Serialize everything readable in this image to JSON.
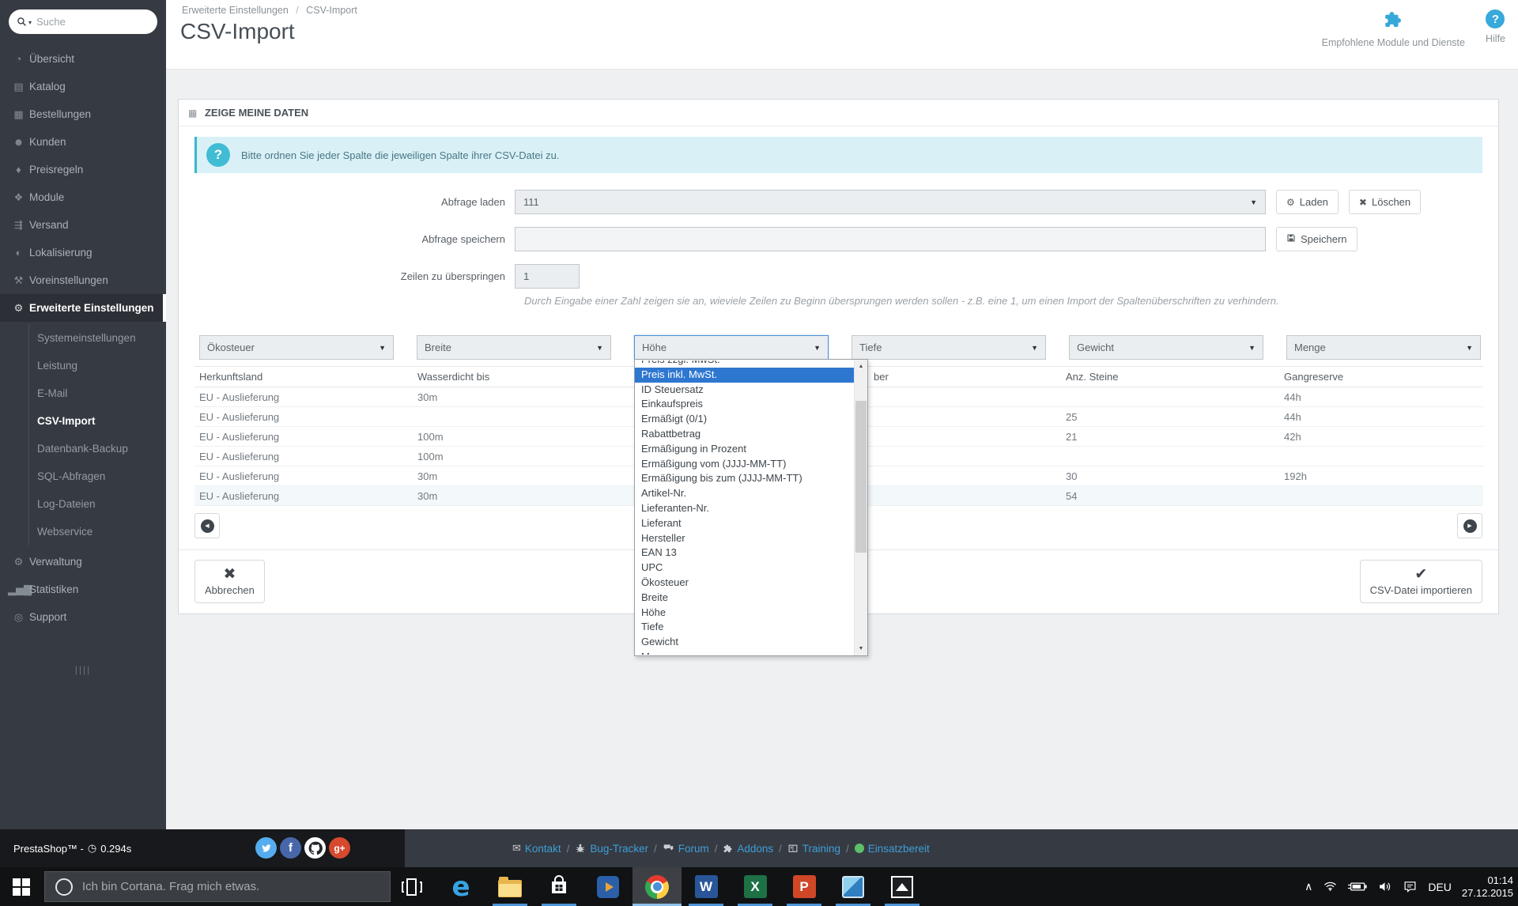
{
  "colors": {
    "accent_blue": "#35a9db",
    "selection_blue": "#2e77d0",
    "alert_teal": "#41bcd5",
    "link_blue": "#3d9fd9",
    "status_green": "#5cc06a"
  },
  "icons": {
    "select_caret": "▼",
    "menu_caret": "▾",
    "gear": "⚙",
    "cross": "✖",
    "check": "✔",
    "question_mark": "?",
    "clock": "◷",
    "prev": "◀",
    "next": "▶",
    "panel": "▦",
    "envelope": "✉",
    "scroll_up": "▲",
    "scroll_down": "▼"
  },
  "sidebar": {
    "search_placeholder": "Suche",
    "menu_top": [
      {
        "icon": "◔",
        "label": "Übersicht"
      },
      {
        "icon": "▤",
        "label": "Katalog"
      },
      {
        "icon": "▦",
        "label": "Bestellungen"
      },
      {
        "icon": "☻",
        "label": "Kunden"
      },
      {
        "icon": "♦",
        "label": "Preisregeln"
      },
      {
        "icon": "❖",
        "label": "Module"
      },
      {
        "icon": "⇶",
        "label": "Versand"
      },
      {
        "icon": "◐",
        "label": "Lokalisierung"
      },
      {
        "icon": "⚒",
        "label": "Voreinstellungen"
      },
      {
        "icon": "⚙",
        "label": "Erweiterte Einstellungen",
        "active": true
      }
    ],
    "submenu": [
      {
        "label": "Systemeinstellungen"
      },
      {
        "label": "Leistung"
      },
      {
        "label": "E-Mail"
      },
      {
        "label": "CSV-Import",
        "active": true
      },
      {
        "label": "Datenbank-Backup"
      },
      {
        "label": "SQL-Abfragen"
      },
      {
        "label": "Log-Dateien"
      },
      {
        "label": "Webservice"
      }
    ],
    "menu_bottom": [
      {
        "icon": "⚙",
        "label": "Verwaltung"
      },
      {
        "icon": "▂▅▇",
        "label": "Statistiken"
      },
      {
        "icon": "◎",
        "label": "Support"
      }
    ],
    "collapse_glyph": "||||"
  },
  "header": {
    "breadcrumb": [
      "Erweiterte Einstellungen",
      "CSV-Import"
    ],
    "breadcrumb_separator": "/",
    "title": "CSV-Import",
    "recommended_modules_label": "Empfohlene Module und Dienste",
    "help_label": "Hilfe"
  },
  "panel": {
    "title": "ZEIGE MEINE DATEN",
    "info_text": "Bitte ordnen Sie jeder Spalte die jeweiligen Spalte ihrer CSV-Datei zu.",
    "form": {
      "load_label": "Abfrage laden",
      "load_value": "111",
      "load_button": "Laden",
      "delete_button": "Löschen",
      "save_label": "Abfrage speichern",
      "save_value": "",
      "save_button": "Speichern",
      "skip_label": "Zeilen zu überspringen",
      "skip_value": "1",
      "skip_help": "Durch Eingabe einer Zahl zeigen sie an, wieviele Zeilen zu Beginn übersprungen werden sollen - z.B. eine 1, um einen Import der Spaltenüberschriften zu verhindern."
    },
    "column_selects": [
      {
        "value": "Ökosteuer"
      },
      {
        "value": "Breite"
      },
      {
        "value": "Höhe",
        "focused": true
      },
      {
        "value": "Tiefe"
      },
      {
        "value": "Gewicht"
      },
      {
        "value": "Menge"
      }
    ],
    "dropdown": {
      "options": [
        {
          "label": "Preis zzgl. MwSt."
        },
        {
          "label": "Preis inkl. MwSt.",
          "selected": true
        },
        {
          "label": "ID Steuersatz"
        },
        {
          "label": "Einkaufspreis"
        },
        {
          "label": "Ermäßigt (0/1)"
        },
        {
          "label": "Rabattbetrag"
        },
        {
          "label": "Ermäßigung in Prozent"
        },
        {
          "label": "Ermäßigung vom (JJJJ-MM-TT)"
        },
        {
          "label": "Ermäßigung bis zum (JJJJ-MM-TT)"
        },
        {
          "label": "Artikel-Nr."
        },
        {
          "label": "Lieferanten-Nr."
        },
        {
          "label": "Lieferant"
        },
        {
          "label": "Hersteller"
        },
        {
          "label": "EAN 13"
        },
        {
          "label": "UPC"
        },
        {
          "label": "Ökosteuer"
        },
        {
          "label": "Breite"
        },
        {
          "label": "Höhe"
        },
        {
          "label": "Tiefe"
        },
        {
          "label": "Gewicht"
        },
        {
          "label": "Menge"
        }
      ]
    },
    "table": {
      "headers": [
        "Herkunftsland",
        "Wasserdicht bis",
        "",
        "ber",
        "Anz. Steine",
        "Gangreserve"
      ],
      "rows": [
        [
          "EU - Auslieferung",
          "30m",
          "",
          "",
          "",
          "44h"
        ],
        [
          "EU - Auslieferung",
          "",
          "",
          "",
          "25",
          "44h"
        ],
        [
          "EU - Auslieferung",
          "100m",
          "",
          "",
          "21",
          "42h"
        ],
        [
          "EU - Auslieferung",
          "100m",
          "",
          "",
          "",
          ""
        ],
        [
          "EU - Auslieferung",
          "30m",
          "",
          "",
          "30",
          "192h"
        ],
        [
          "EU - Auslieferung",
          "30m",
          "",
          "",
          "54",
          ""
        ]
      ]
    },
    "cancel_button": "Abbrechen",
    "import_button": "CSV-Datei importieren"
  },
  "footer": {
    "brand": "PrestaShop™ -",
    "load_time": "0.294s",
    "separator": "/",
    "links": [
      {
        "label": "Kontakt"
      },
      {
        "label": "Bug-Tracker"
      },
      {
        "label": "Forum"
      },
      {
        "label": "Addons"
      },
      {
        "label": "Training"
      },
      {
        "label": "Einsatzbereit"
      }
    ]
  },
  "taskbar": {
    "cortana_placeholder": "Ich bin Cortana. Frag mich etwas.",
    "language": "DEU",
    "time": "01:14",
    "date": "27.12.2015",
    "apps": [
      "task-view",
      "edge",
      "file-explorer",
      "store",
      "media-player",
      "chrome",
      "word",
      "excel",
      "powerpoint",
      "image-viewer",
      "photos"
    ]
  }
}
